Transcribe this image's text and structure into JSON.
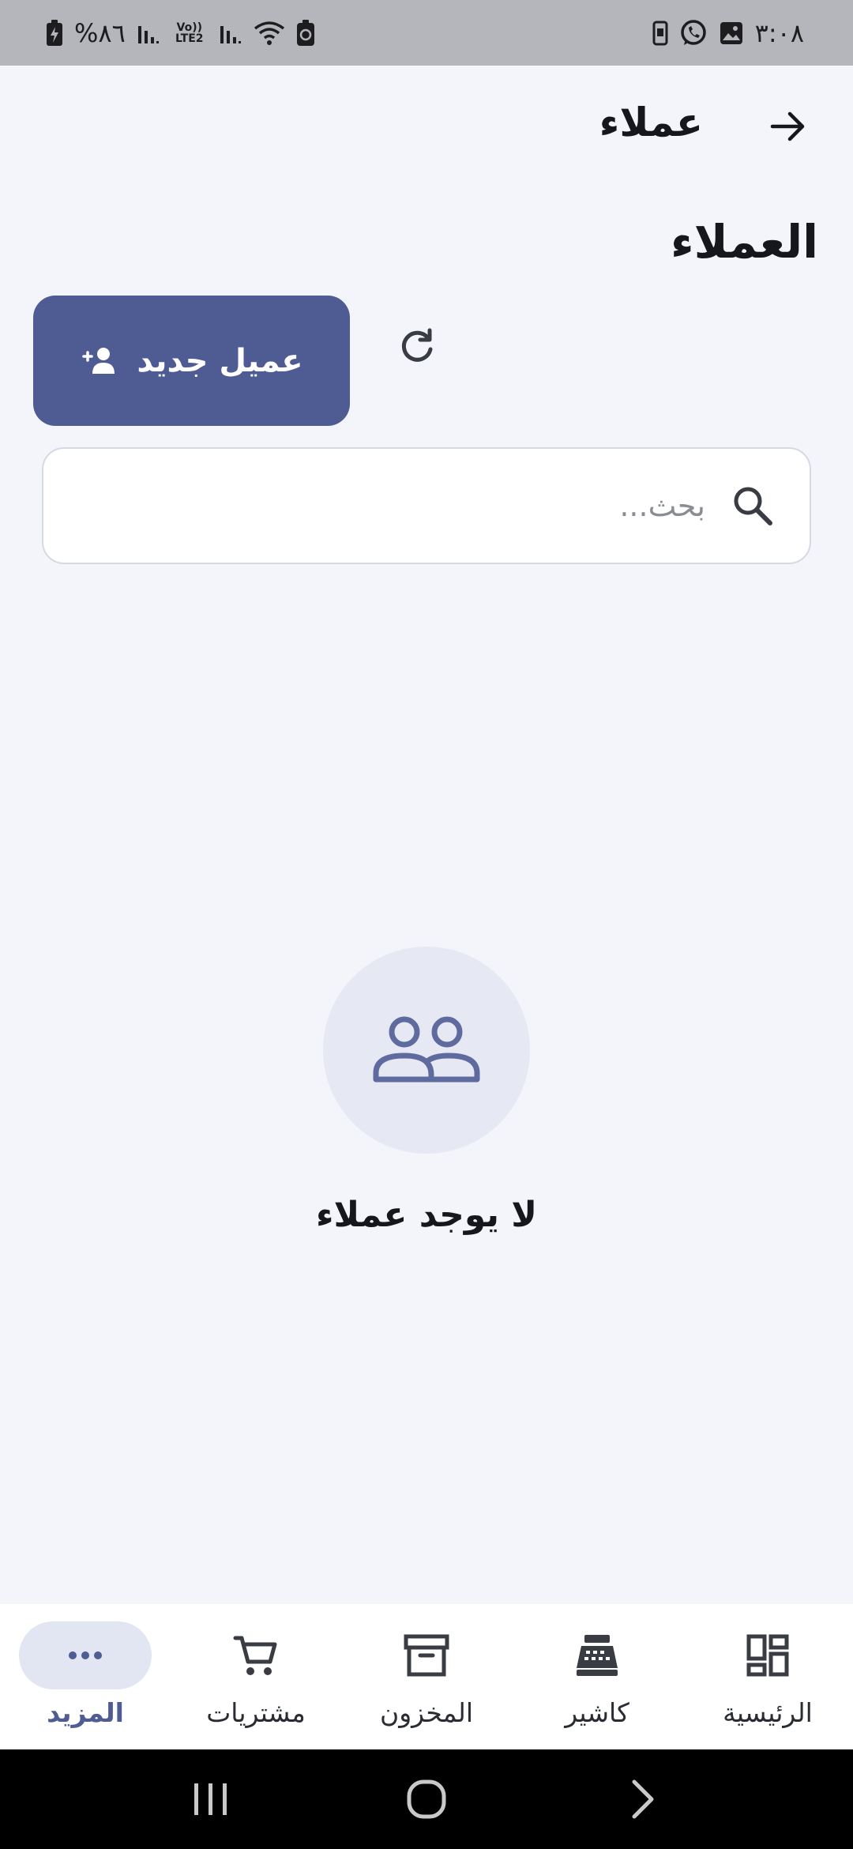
{
  "status_bar": {
    "time": "٣:٠٨",
    "battery": "%٨٦",
    "network_label": "Vo)) LTE2"
  },
  "header": {
    "title": "عملاء",
    "back_icon": "arrow-right-icon"
  },
  "section": {
    "title": "العملاء"
  },
  "actions": {
    "new_customer_label": "عميل جديد",
    "new_customer_icon": "person-add-icon",
    "refresh_icon": "refresh-icon"
  },
  "search": {
    "placeholder": "بحث...",
    "value": "",
    "icon": "search-icon"
  },
  "empty_state": {
    "icon": "people-icon",
    "message": "لا يوجد عملاء"
  },
  "bottom_nav": {
    "items": [
      {
        "label": "المزيد",
        "icon": "more-horizontal-icon",
        "active": true
      },
      {
        "label": "مشتريات",
        "icon": "cart-icon",
        "active": false
      },
      {
        "label": "المخزون",
        "icon": "archive-box-icon",
        "active": false
      },
      {
        "label": "كاشير",
        "icon": "cash-register-icon",
        "active": false
      },
      {
        "label": "الرئيسية",
        "icon": "dashboard-icon",
        "active": false
      }
    ]
  },
  "colors": {
    "primary": "#4f5b93",
    "background": "#f4f5fb",
    "status_bar": "#b5b6bb",
    "empty_circle": "#e6e8f3"
  }
}
